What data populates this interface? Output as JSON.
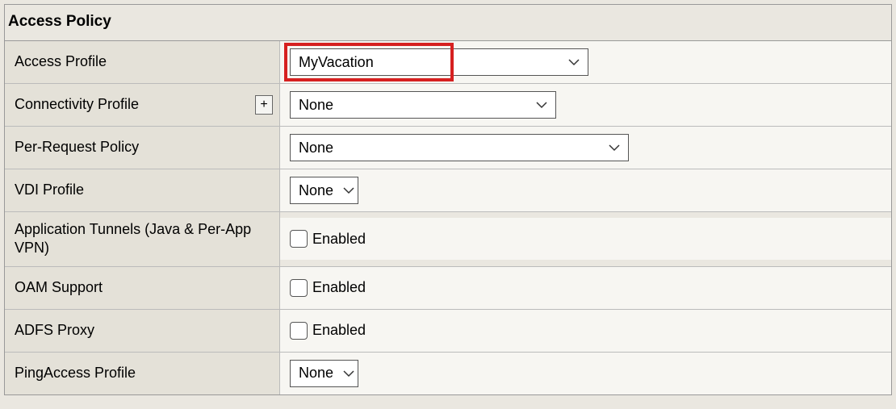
{
  "panel": {
    "title": "Access Policy"
  },
  "rows": {
    "access_profile": {
      "label": "Access Profile",
      "value": "MyVacation"
    },
    "connectivity_profile": {
      "label": "Connectivity Profile",
      "plus": "+",
      "value": "None"
    },
    "per_request_policy": {
      "label": "Per-Request Policy",
      "value": "None"
    },
    "vdi_profile": {
      "label": "VDI Profile",
      "value": "None"
    },
    "app_tunnels": {
      "label": "Application Tunnels (Java & Per-App VPN)",
      "checkbox_label": "Enabled",
      "checked": false
    },
    "oam_support": {
      "label": "OAM Support",
      "checkbox_label": "Enabled",
      "checked": false
    },
    "adfs_proxy": {
      "label": "ADFS Proxy",
      "checkbox_label": "Enabled",
      "checked": false
    },
    "pingaccess_profile": {
      "label": "PingAccess Profile",
      "value": "None"
    }
  }
}
